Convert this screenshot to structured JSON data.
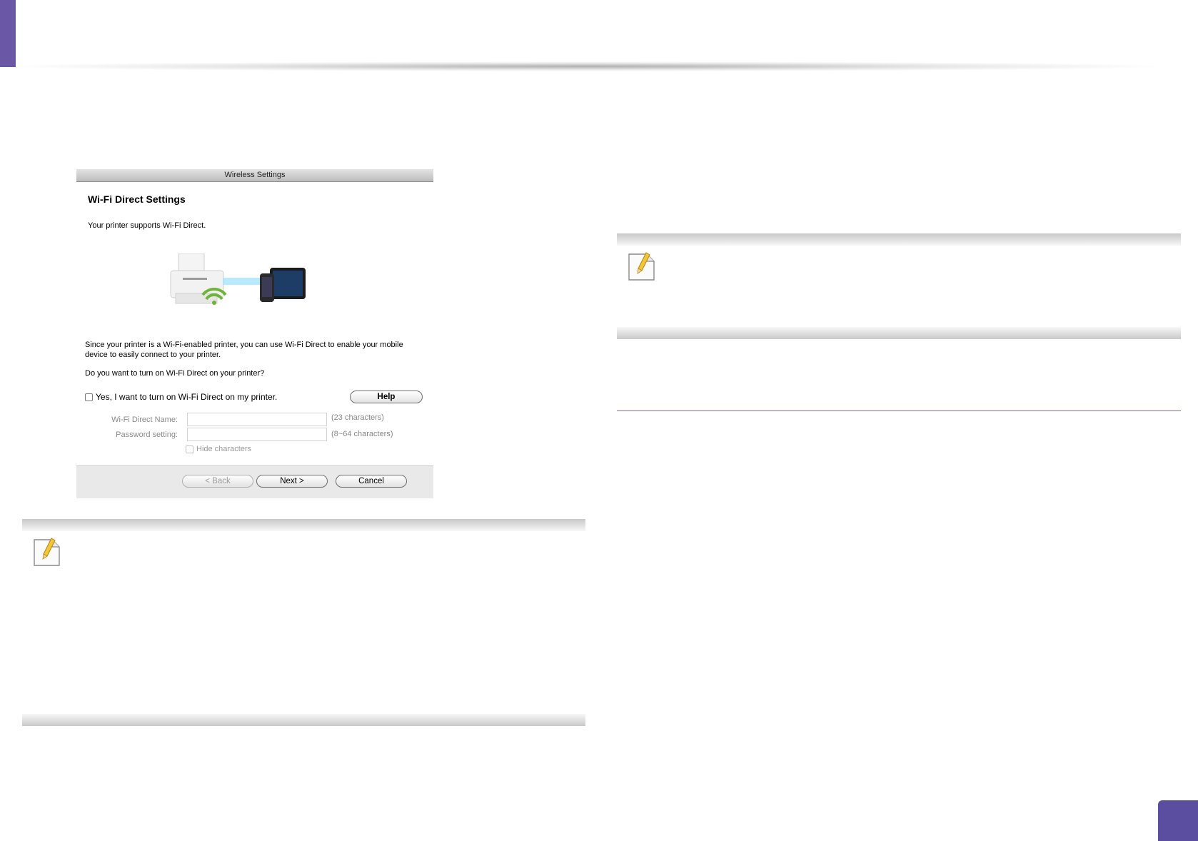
{
  "dialog": {
    "window_title": "Wireless Settings",
    "heading": "Wi-Fi Direct Settings",
    "supports_text": "Your printer supports Wi-Fi Direct.",
    "description": "Since your printer is a Wi-Fi-enabled printer, you can use Wi-Fi Direct to enable your mobile device to easily connect to your printer.",
    "question": "Do you want to turn on Wi-Fi Direct on your printer?",
    "enable_checkbox_label": "Yes, I want to turn on Wi-Fi Direct on my printer.",
    "enable_checked": false,
    "help_label": "Help",
    "name_label": "Wi-Fi Direct Name:",
    "name_value": "",
    "name_hint": "(23 characters)",
    "password_label": "Password setting:",
    "password_value": "",
    "password_hint": "(8~64 characters)",
    "hide_characters_label": "Hide characters",
    "back_label": "< Back",
    "next_label": "Next >",
    "cancel_label": "Cancel"
  },
  "colors": {
    "accent": "#5b4ea0",
    "wifi_green": "#6fb33a"
  }
}
